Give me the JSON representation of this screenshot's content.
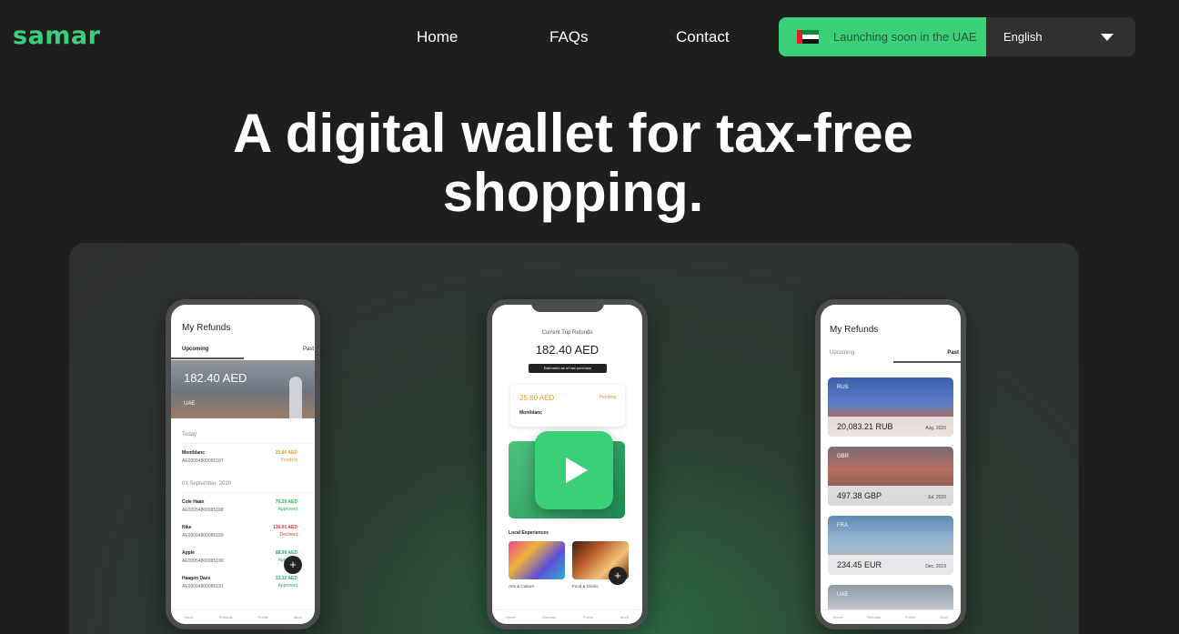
{
  "header": {
    "logo": "samar",
    "nav": [
      "Home",
      "FAQs",
      "Contact"
    ],
    "launch_text": "Launching soon in the UAE",
    "language": "English"
  },
  "hero": {
    "line1": "A digital wallet for tax-free",
    "line2": "shopping."
  },
  "colors": {
    "brand_green": "#3ad07a",
    "bg": "#1e1e1e"
  },
  "phone1": {
    "title": "My Refunds",
    "tabs": [
      "Upcoming",
      "Past"
    ],
    "card_amount": "182.40 AED",
    "card_country": "UAE",
    "section_today": "Today",
    "section_date": "01 September, 2020",
    "rows": [
      {
        "name": "Montblanc",
        "id": "AE00054800085187",
        "amount": "25.80 AED",
        "status": "Pending"
      },
      {
        "name": "Cole Haan",
        "id": "AE00054800085188",
        "amount": "70.29 AED",
        "status": "Approved"
      },
      {
        "name": "Nike",
        "id": "AE00054800085189",
        "amount": "136.01 AED",
        "status": "Declined"
      },
      {
        "name": "Apple",
        "id": "AE00054800085190",
        "amount": "88.99 AED",
        "status": "Approved"
      },
      {
        "name": "Haagen Dazs",
        "id": "AE00054800085191",
        "amount": "12.12 AED",
        "status": "Approved"
      }
    ],
    "bottom_nav": [
      "Home",
      "Refunds",
      "Profile",
      "More"
    ]
  },
  "phone2": {
    "heading": "Current Trip Refunds",
    "amount": "182.40 AED",
    "estimate": "Estimated as of last purchase",
    "card_amount": "25.80 AED",
    "card_status": "Pending",
    "card_merchant": "Montblanc",
    "local_title": "Local Experiences",
    "experiences": [
      "Arts & Culture",
      "Food & Drinks"
    ],
    "bottom_nav": [
      "Home",
      "Refunds",
      "Profile",
      "More"
    ]
  },
  "phone3": {
    "title": "My Refunds",
    "tabs": [
      "Upcoming",
      "Past"
    ],
    "cards": [
      {
        "country": "RUS",
        "amount": "20,083.21 RUB",
        "date": "Aug. 2020"
      },
      {
        "country": "GBR",
        "amount": "497.38 GBP",
        "date": "Jul. 2020"
      },
      {
        "country": "FRA",
        "amount": "234.45 EUR",
        "date": "Dec. 2019"
      },
      {
        "country": "UAE",
        "amount": "",
        "date": ""
      }
    ],
    "bottom_nav": [
      "Home",
      "Refunds",
      "Profile",
      "More"
    ]
  }
}
